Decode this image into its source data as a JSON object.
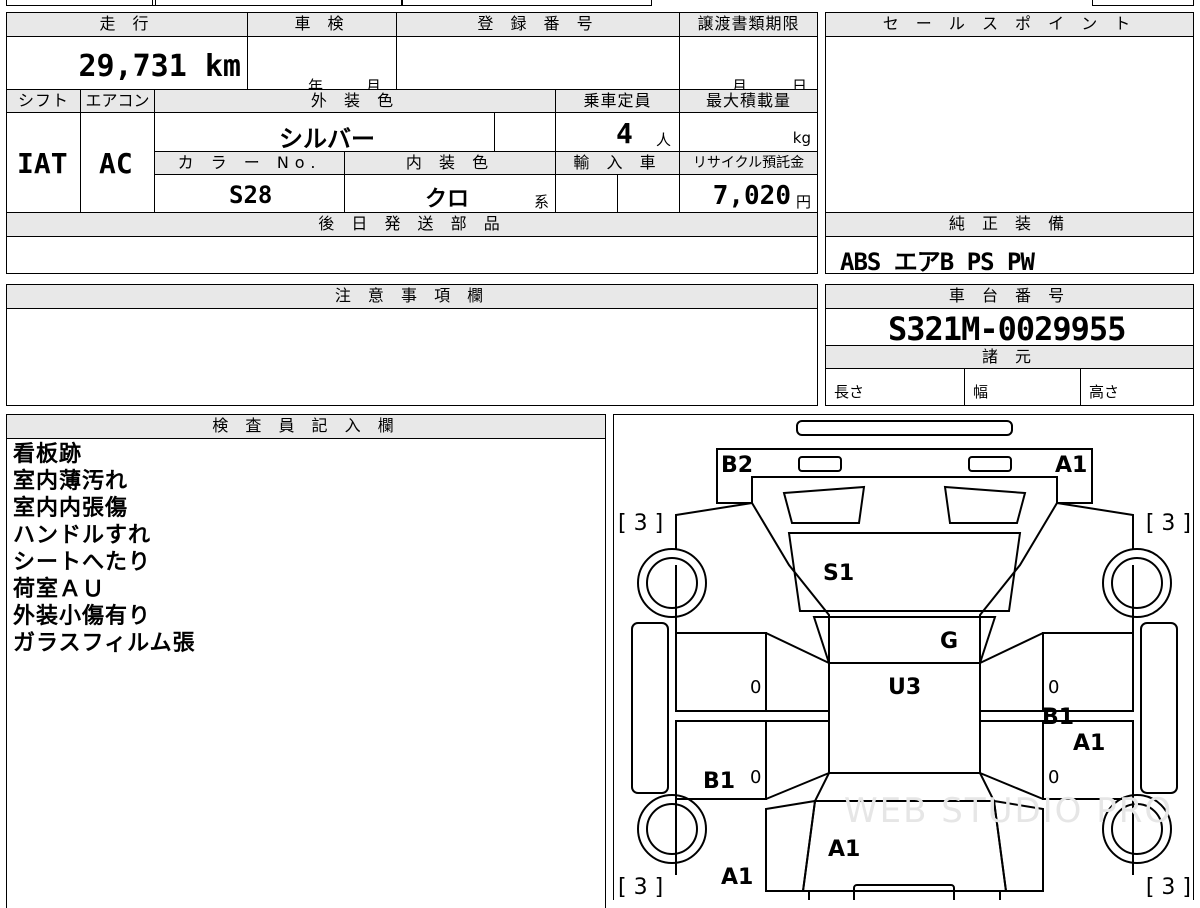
{
  "top_form": {
    "mileage_label": "走 行",
    "mileage_value": "29,731",
    "mileage_unit": "km",
    "inspection_label": "車 検",
    "inspection_year": "年",
    "inspection_month": "月",
    "registration_label": "登 録 番 号",
    "transfer_deadline_label": "譲渡書類期限",
    "transfer_month": "月",
    "transfer_day": "日",
    "shift_label": "シフト",
    "shift_value": "IAT",
    "ac_label": "エアコン",
    "ac_value": "AC",
    "exterior_color_label": "外 装 色",
    "exterior_color_value": "シルバー",
    "capacity_label": "乗車定員",
    "capacity_value": "4",
    "capacity_unit": "人",
    "max_load_label": "最大積載量",
    "max_load_unit": "kg",
    "color_no_label": "カ ラ ー No.",
    "color_no_value": "S28",
    "interior_color_label": "内 装 色",
    "interior_color_value": "クロ",
    "interior_color_suffix": "系",
    "import_label": "輸 入 車",
    "recycle_label": "リサイクル預託金",
    "recycle_value": "7,020",
    "recycle_unit": "円",
    "later_parts_label": "後 日 発 送 部 品"
  },
  "sales_point": {
    "label": "セ ー ル ス ポ イ ン ト"
  },
  "equipment": {
    "label": "純 正 装 備",
    "value": "ABS エアB PS PW"
  },
  "notes_section": {
    "label": "注 意 事 項 欄"
  },
  "chassis": {
    "label": "車 台 番 号",
    "value": "S321M-0029955",
    "specs_label": "諸 元",
    "length_label": "長さ",
    "width_label": "幅",
    "height_label": "高さ"
  },
  "inspector": {
    "label": "検 査 員 記 入 欄",
    "lines": [
      "看板跡",
      "室内薄汚れ",
      "室内内張傷",
      "ハンドルすれ",
      "シートへたり",
      "荷室ＡＵ",
      "外装小傷有り",
      "ガラスフィルム張"
    ]
  },
  "diagram": {
    "marks": {
      "b2": "B2",
      "a1_top": "A1",
      "s1": "S1",
      "g": "G",
      "u3": "U3",
      "b1_right": "B1",
      "a1_right": "A1",
      "b1_left": "B1",
      "a1_rear": "A1",
      "a1_bottom_left": "A1",
      "zero": "0"
    },
    "corner_bracket": "[ 3 ]",
    "watermark": "WEB STUDIO PRO"
  }
}
